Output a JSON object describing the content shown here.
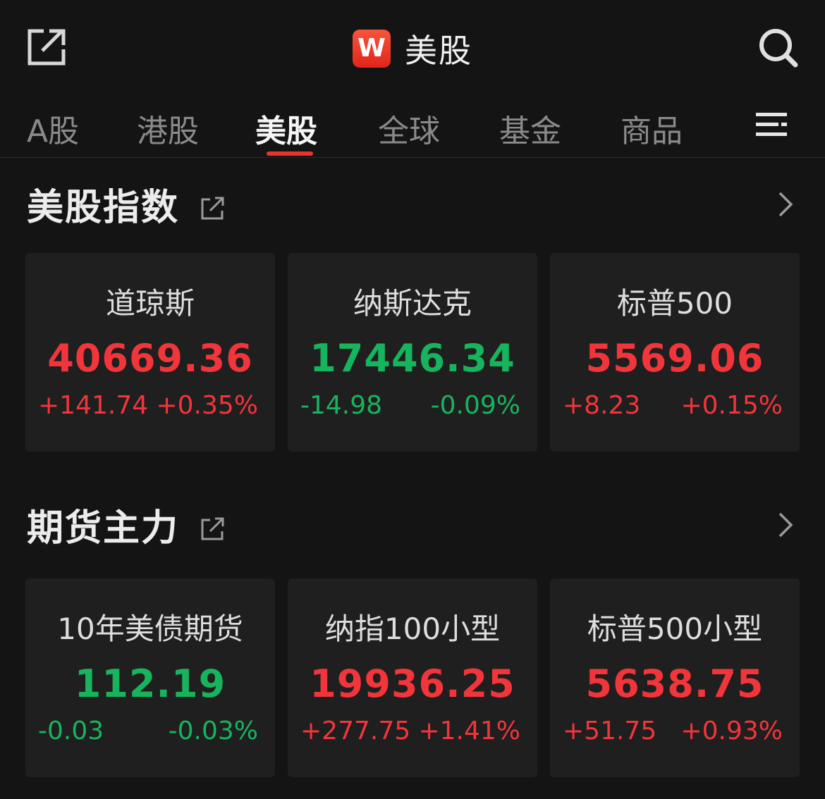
{
  "header": {
    "logo_letter": "W",
    "title": "美股"
  },
  "tabs": [
    {
      "label": "A股"
    },
    {
      "label": "港股"
    },
    {
      "label": "美股"
    },
    {
      "label": "全球"
    },
    {
      "label": "基金"
    },
    {
      "label": "商品"
    }
  ],
  "sections": [
    {
      "title": "美股指数",
      "cards": [
        {
          "name": "道琼斯",
          "value": "40669.36",
          "change": "+141.74",
          "percent": "+0.35%",
          "direction": "up"
        },
        {
          "name": "纳斯达克",
          "value": "17446.34",
          "change": "-14.98",
          "percent": "-0.09%",
          "direction": "down"
        },
        {
          "name": "标普500",
          "value": "5569.06",
          "change": "+8.23",
          "percent": "+0.15%",
          "direction": "up"
        }
      ]
    },
    {
      "title": "期货主力",
      "cards": [
        {
          "name": "10年美债期货",
          "value": "112.19",
          "change": "-0.03",
          "percent": "-0.03%",
          "direction": "down"
        },
        {
          "name": "纳指100小型",
          "value": "19936.25",
          "change": "+277.75",
          "percent": "+1.41%",
          "direction": "up"
        },
        {
          "name": "标普500小型",
          "value": "5638.75",
          "change": "+51.75",
          "percent": "+0.93%",
          "direction": "up"
        }
      ]
    }
  ],
  "colors": {
    "up": "#f2353a",
    "down": "#17b45e",
    "accent": "#e8352c",
    "background": "#141414",
    "card": "#1f1f1f"
  },
  "icons": {
    "share": "share-icon",
    "search": "search-icon",
    "menu": "menu-icon",
    "chevron": "chevron-right-icon"
  }
}
